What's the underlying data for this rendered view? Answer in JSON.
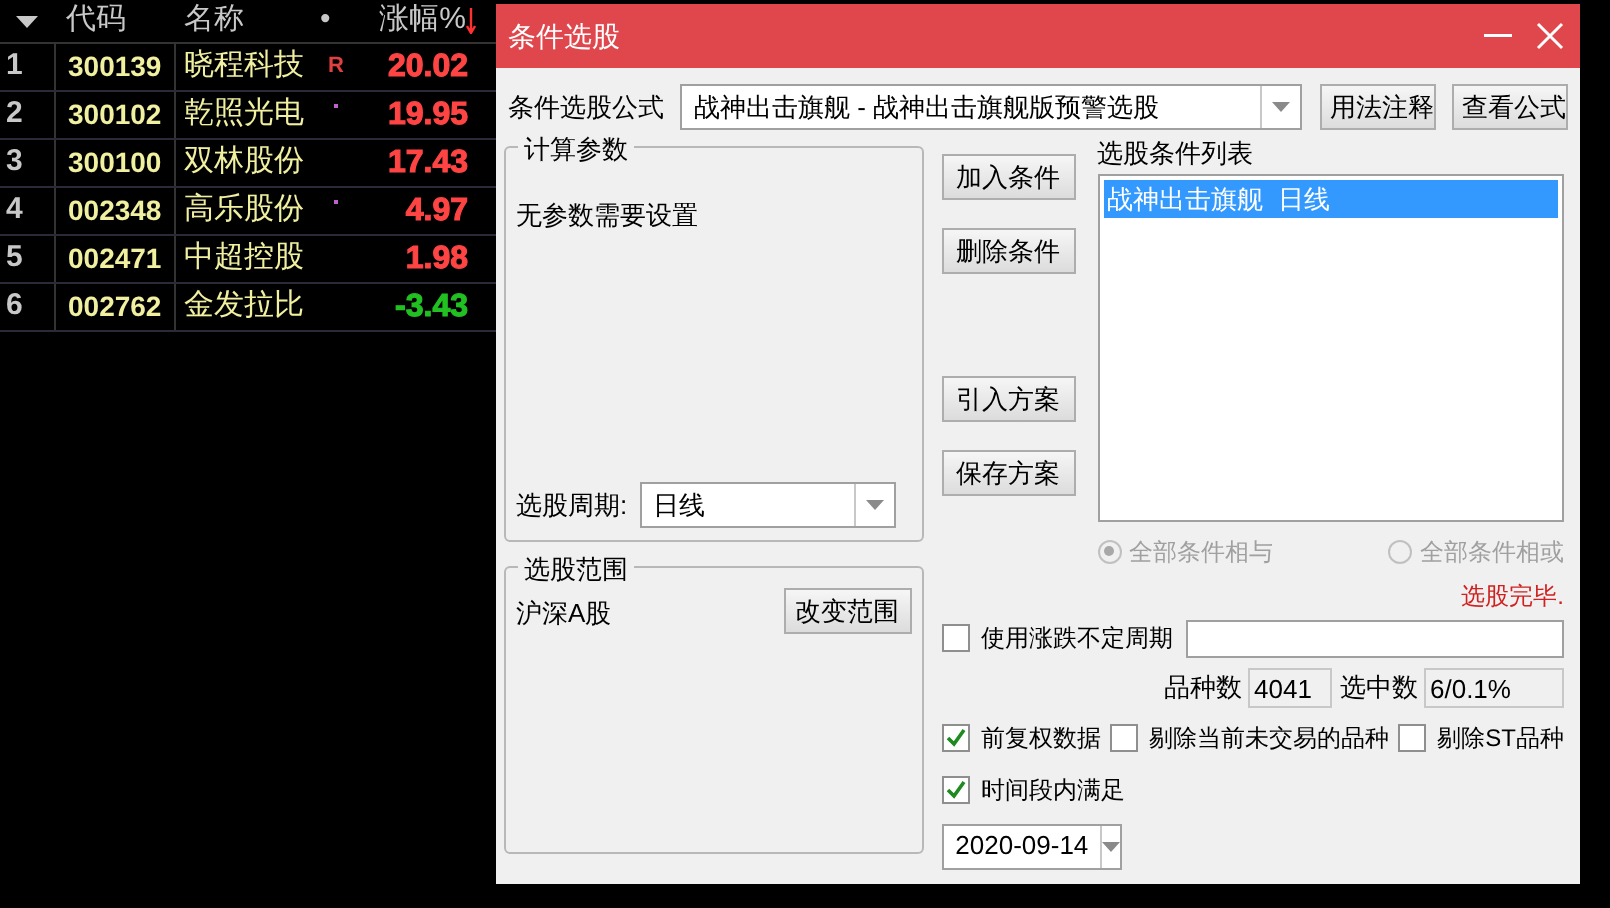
{
  "table": {
    "columns": [
      "代码",
      "名称",
      "•",
      "涨幅%"
    ],
    "rows": [
      {
        "index": "1",
        "code": "300139",
        "name": "晓程科技",
        "flag": {
          "kind": "letter",
          "text": "R"
        },
        "change": "20.02",
        "color": "#ff4444"
      },
      {
        "index": "2",
        "code": "300102",
        "name": "乾照光电",
        "flag": {
          "kind": "dot"
        },
        "change": "19.95",
        "color": "#ff4444"
      },
      {
        "index": "3",
        "code": "300100",
        "name": "双林股份",
        "change": "17.43",
        "color": "#ff4444"
      },
      {
        "index": "4",
        "code": "002348",
        "name": "高乐股份",
        "flag": {
          "kind": "dot"
        },
        "change": "4.97",
        "color": "#ff4444"
      },
      {
        "index": "5",
        "code": "002471",
        "name": "中超控股",
        "change": "1.98",
        "color": "#ff4444"
      },
      {
        "index": "6",
        "code": "002762",
        "name": "金发拉比",
        "change": "-3.43",
        "color": "#22c022"
      }
    ]
  },
  "dialog": {
    "title": "条件选股",
    "formula": {
      "label": "条件选股公式",
      "value": "战神出击旗舰 - 战神出击旗舰版预警选股"
    },
    "top_buttons": [
      "用法注释",
      "查看公式"
    ],
    "params_group": {
      "title": "计算参数",
      "text": "无参数需要设置",
      "period": {
        "label": "选股周期:",
        "value": "日线"
      }
    },
    "action_buttons": [
      "加入条件",
      "删除条件",
      "引入方案",
      "保存方案"
    ],
    "condition_list": {
      "title": "选股条件列表",
      "items": [
        {
          "text": "战神出击旗舰  日线",
          "selected": true
        }
      ]
    },
    "logic_options": [
      {
        "label": "全部条件相与",
        "selected": true,
        "disabled": true
      },
      {
        "label": "全部条件相或",
        "selected": false,
        "disabled": true
      }
    ],
    "status": "选股完毕.",
    "undetermined_period": {
      "label": "使用涨跌不定周期",
      "checked": false
    },
    "counts": [
      {
        "label": "品种数",
        "value": "4041"
      },
      {
        "label": "选中数",
        "value": "6/0.1%"
      }
    ],
    "options": [
      {
        "label": "前复权数据",
        "checked": true
      },
      {
        "label": "剔除当前未交易的品种",
        "checked": false
      },
      {
        "label": "剔除ST品种",
        "checked": false
      }
    ],
    "time_filter": {
      "label": "时间段内满足",
      "checked": true
    },
    "date": "2020-09-14",
    "range_group": {
      "title": "选股范围",
      "value": "沪深A股",
      "button": "改变范围"
    }
  }
}
